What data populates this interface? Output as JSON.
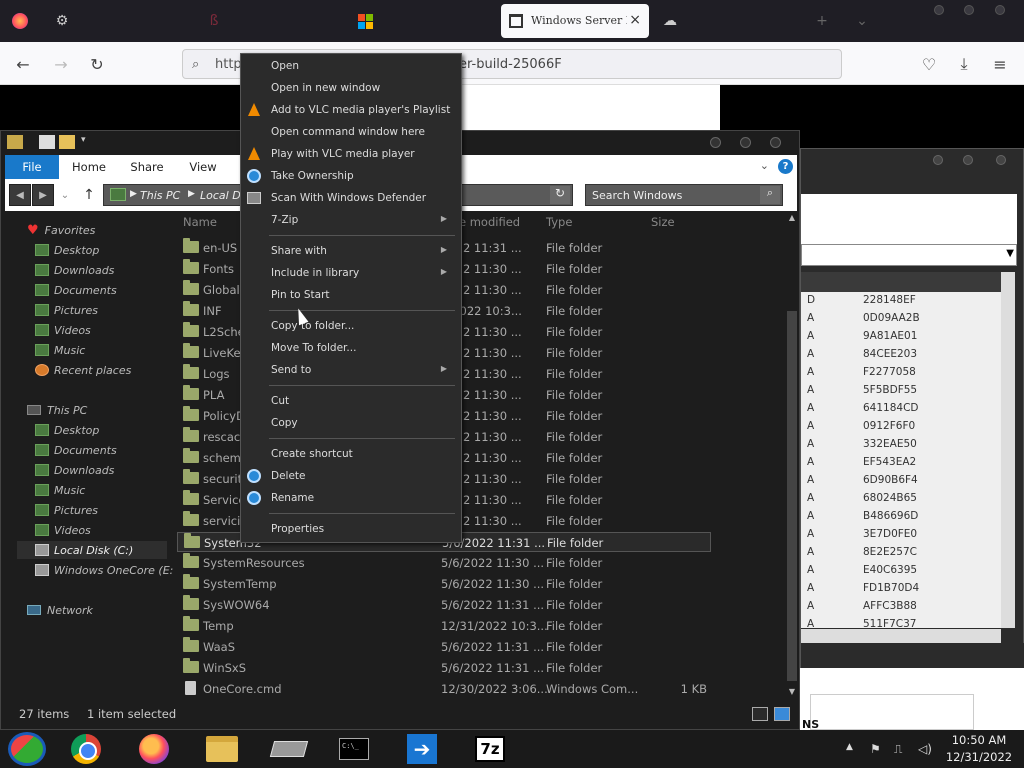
{
  "browser": {
    "active_tab_title": "Windows Server B",
    "url_prefix": "http",
    "url_suffix": "er-build-25066F",
    "tab_close": "×",
    "new_tab": "+",
    "list_tabs": "⌄"
  },
  "explorer": {
    "ribbon_tabs": [
      "File",
      "Home",
      "Share",
      "View"
    ],
    "help_label": "?",
    "breadcrumb": [
      "This PC",
      "Local Di"
    ],
    "search_placeholder": "Search Windows",
    "columns": {
      "name": "Name",
      "date_modified": "e modified",
      "type": "Type",
      "size": "Size"
    },
    "nav": {
      "favorites_label": "Favorites",
      "favorites": [
        "Desktop",
        "Downloads",
        "Documents",
        "Pictures",
        "Videos",
        "Music",
        "Recent places"
      ],
      "thispc_label": "This PC",
      "thispc": [
        "Desktop",
        "Documents",
        "Downloads",
        "Music",
        "Pictures",
        "Videos"
      ],
      "drives": [
        "Local Disk (C:)",
        "Windows OneCore (E:"
      ],
      "network_label": "Network"
    },
    "files": [
      {
        "name": "en-US",
        "date": "2022 11:31 ...",
        "type": "File folder",
        "size": ""
      },
      {
        "name": "Fonts",
        "date": "2022 11:30 ...",
        "type": "File folder",
        "size": ""
      },
      {
        "name": "Global",
        "date": "2022 11:30 ...",
        "type": "File folder",
        "size": ""
      },
      {
        "name": "INF",
        "date": "1/2022 10:3...",
        "type": "File folder",
        "size": ""
      },
      {
        "name": "L2Sche",
        "date": "2022 11:30 ...",
        "type": "File folder",
        "size": ""
      },
      {
        "name": "LiveKer",
        "date": "2022 11:30 ...",
        "type": "File folder",
        "size": ""
      },
      {
        "name": "Logs",
        "date": "2022 11:30 ...",
        "type": "File folder",
        "size": ""
      },
      {
        "name": "PLA",
        "date": "2022 11:30 ...",
        "type": "File folder",
        "size": ""
      },
      {
        "name": "PolicyD",
        "date": "2022 11:30 ...",
        "type": "File folder",
        "size": ""
      },
      {
        "name": "rescach",
        "date": "2022 11:30 ...",
        "type": "File folder",
        "size": ""
      },
      {
        "name": "schema",
        "date": "2022 11:30 ...",
        "type": "File folder",
        "size": ""
      },
      {
        "name": "securit",
        "date": "2022 11:30 ...",
        "type": "File folder",
        "size": ""
      },
      {
        "name": "Service",
        "date": "2022 11:30 ...",
        "type": "File folder",
        "size": ""
      },
      {
        "name": "servici",
        "date": "2022 11:30 ...",
        "type": "File folder",
        "size": ""
      },
      {
        "name": "System32",
        "date": "5/6/2022 11:31 ...",
        "type": "File folder",
        "size": ""
      },
      {
        "name": "SystemResources",
        "date": "5/6/2022 11:30 ...",
        "type": "File folder",
        "size": ""
      },
      {
        "name": "SystemTemp",
        "date": "5/6/2022 11:30 ...",
        "type": "File folder",
        "size": ""
      },
      {
        "name": "SysWOW64",
        "date": "5/6/2022 11:31 ...",
        "type": "File folder",
        "size": ""
      },
      {
        "name": "Temp",
        "date": "12/31/2022 10:3...",
        "type": "File folder",
        "size": ""
      },
      {
        "name": "WaaS",
        "date": "5/6/2022 11:31 ...",
        "type": "File folder",
        "size": ""
      },
      {
        "name": "WinSxS",
        "date": "5/6/2022 11:31 ...",
        "type": "File folder",
        "size": ""
      },
      {
        "name": "OneCore.cmd",
        "date": "12/30/2022 3:06...",
        "type": "Windows Com...",
        "size": "1 KB"
      }
    ],
    "status": {
      "items": "27 items",
      "selected": "1 item selected"
    }
  },
  "context_menu": {
    "items": [
      "Open",
      "Open in new window",
      "Add to VLC media player's Playlist",
      "Open command window here",
      "Play with VLC media player",
      "Take Ownership",
      "Scan With Windows Defender",
      "7-Zip",
      "Share with",
      "Include in library",
      "Pin to Start",
      "Copy to folder...",
      "Move To folder...",
      "Send to",
      "Cut",
      "Copy",
      "Create shortcut",
      "Delete",
      "Rename",
      "Properties"
    ]
  },
  "bgwindow": {
    "rows": [
      {
        "a": "D",
        "h": "228148EF"
      },
      {
        "a": "A",
        "h": "0D09AA2B"
      },
      {
        "a": "A",
        "h": "9A81AE01"
      },
      {
        "a": "A",
        "h": "84CEE203"
      },
      {
        "a": "A",
        "h": "F2277058"
      },
      {
        "a": "A",
        "h": "5F5BDF55"
      },
      {
        "a": "A",
        "h": "641184CD"
      },
      {
        "a": "A",
        "h": "0912F6F0"
      },
      {
        "a": "A",
        "h": "332EAE50"
      },
      {
        "a": "A",
        "h": "EF543EA2"
      },
      {
        "a": "A",
        "h": "6D90B6F4"
      },
      {
        "a": "A",
        "h": "68024B65"
      },
      {
        "a": "A",
        "h": "B486696D"
      },
      {
        "a": "A",
        "h": "3E7D0FE0"
      },
      {
        "a": "A",
        "h": "8E2E257C"
      },
      {
        "a": "A",
        "h": "E40C6395"
      },
      {
        "a": "A",
        "h": "FD1B70D4"
      },
      {
        "a": "A",
        "h": "AFFC3B88"
      },
      {
        "a": "A",
        "h": "511F7C37"
      }
    ],
    "bottom_text": "NS"
  },
  "taskbar": {
    "time": "10:50 AM",
    "date": "12/31/2022",
    "sevenzip_label": "7z"
  }
}
